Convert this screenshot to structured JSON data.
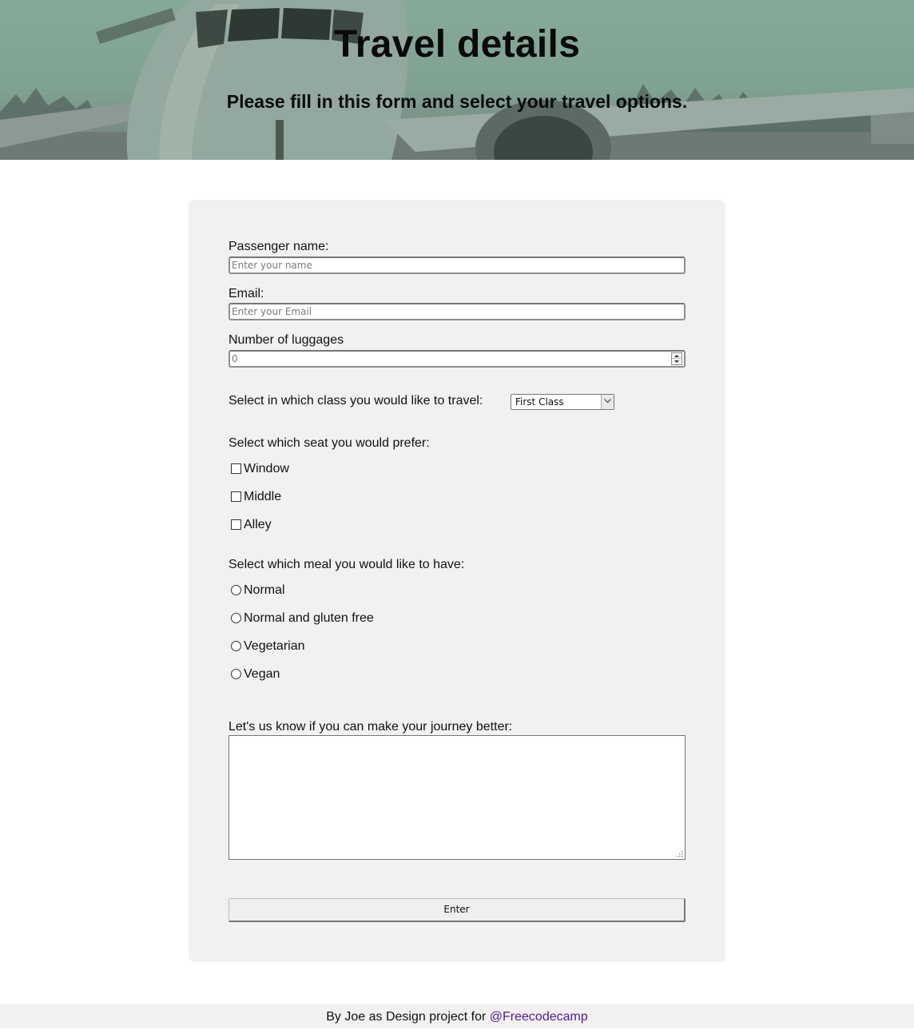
{
  "header": {
    "title": "Travel details",
    "subtitle": "Please fill in this form and select your travel options."
  },
  "form": {
    "name_label": "Passenger name:",
    "name_placeholder": "Enter your name",
    "email_label": "Email:",
    "email_placeholder": "Enter your Email",
    "luggage_label": "Number of luggages",
    "luggage_placeholder": "0",
    "class_label": "Select in which class you would like to travel:",
    "class_selected": "First Class",
    "seat_label": "Select which seat you would prefer:",
    "seats": [
      {
        "label": "Window",
        "checked": false
      },
      {
        "label": "Middle",
        "checked": false
      },
      {
        "label": "Alley",
        "checked": false
      }
    ],
    "meal_label": "Select which meal you would like to have:",
    "meals": [
      {
        "label": "Normal",
        "selected": false
      },
      {
        "label": "Normal and gluten free",
        "selected": false
      },
      {
        "label": "Vegetarian",
        "selected": false
      },
      {
        "label": "Vegan",
        "selected": false
      }
    ],
    "comments_label": "Let's us know if you can make your journey better:",
    "comments_value": "",
    "submit_label": "Enter"
  },
  "footer": {
    "text": "By Joe as Design project for ",
    "link_text": "@Freecodecamp"
  },
  "colors": {
    "hero_tint": "#86a99a",
    "card_bg": "#f2f0f1",
    "footer_bg": "#f2f0f1",
    "link": "#551a8b"
  }
}
